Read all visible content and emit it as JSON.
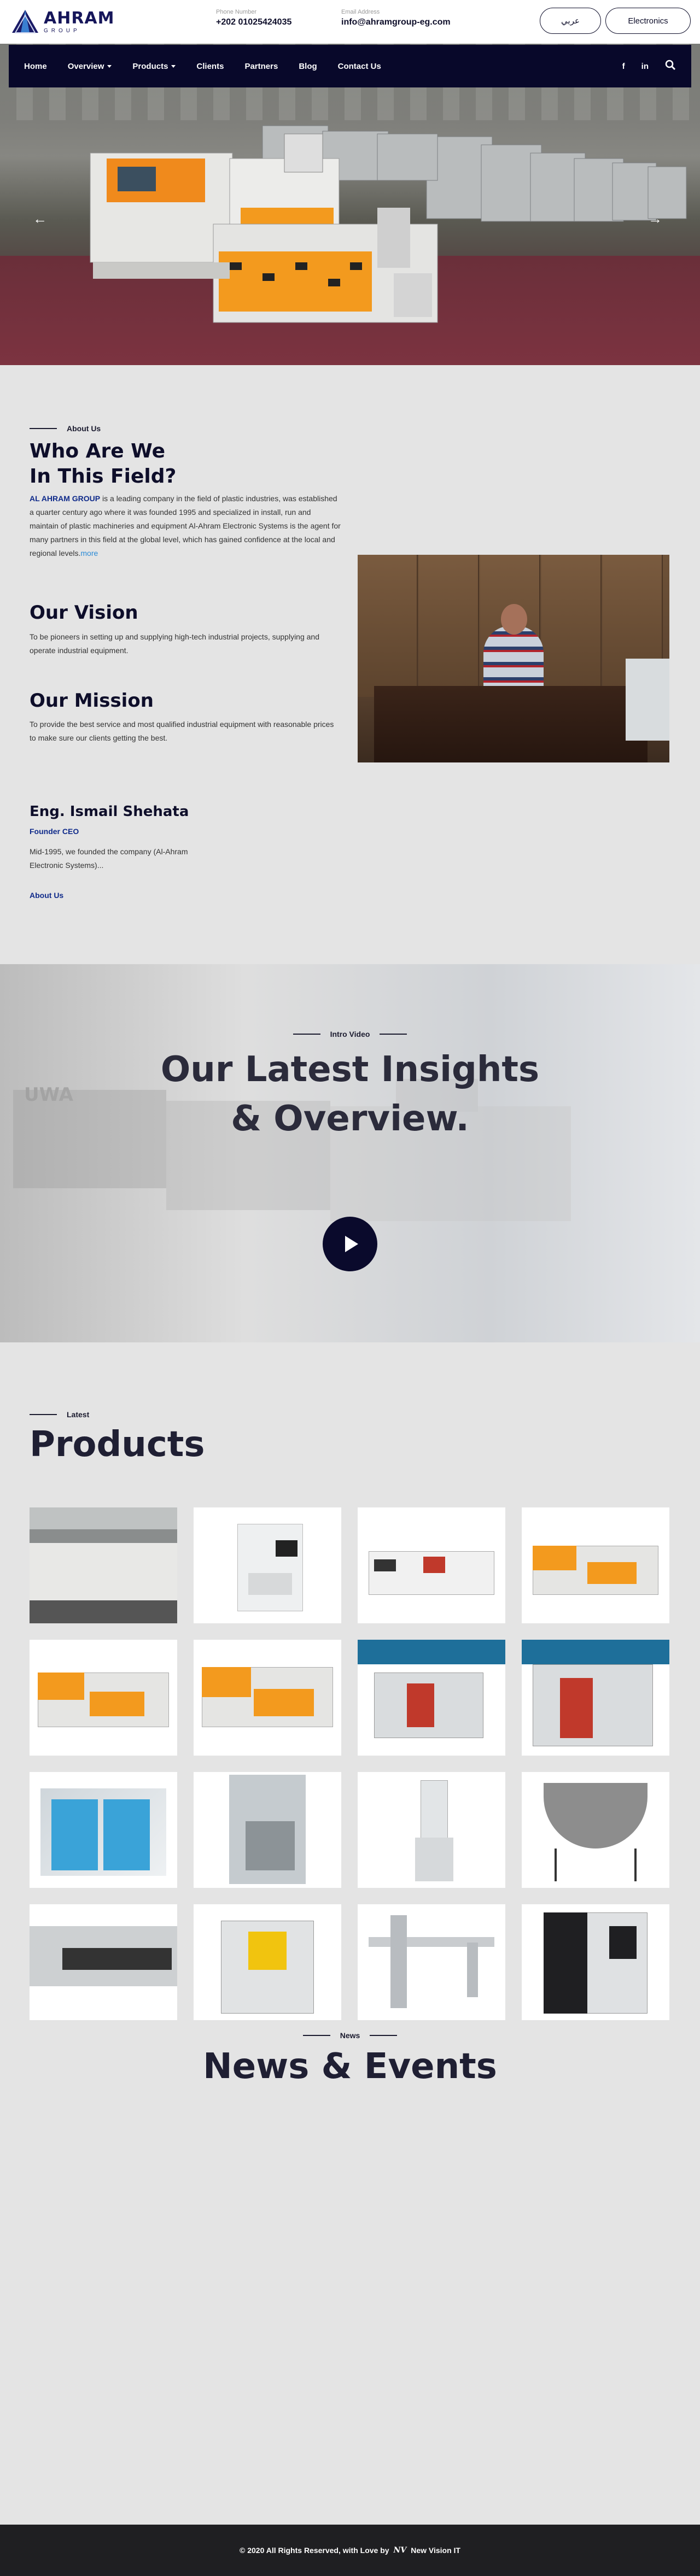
{
  "header": {
    "logo_name": "AHRAM",
    "logo_sub": "GROUP",
    "phone_label": "Phone Number",
    "phone_value": "+202 01025424035",
    "email_label": "Email Address",
    "email_value": "info@ahramgroup-eg.com",
    "lang_button": "عربي",
    "electronics_button": "Electronics"
  },
  "nav": {
    "items": [
      {
        "label": "Home"
      },
      {
        "label": "Overview"
      },
      {
        "label": "Products"
      },
      {
        "label": "Clients"
      },
      {
        "label": "Partners"
      },
      {
        "label": "Blog"
      },
      {
        "label": "Contact Us"
      }
    ],
    "social_facebook": "f",
    "social_linkedin": "in"
  },
  "hero": {
    "prev_arrow": "←",
    "next_arrow": "→"
  },
  "about": {
    "eyebrow": "About Us",
    "title_line1": "Who Are We",
    "title_line2": "In This Field?",
    "company_name": "AL AHRAM GROUP",
    "intro": " is a leading company in the field of plastic industries, was established a quarter century ago where it was founded 1995 and specialized in install, run and maintain of plastic machineries and equipment Al-Ahram Electronic Systems is the agent for many partners in this field at the global level, which has gained confidence at the local and regional levels.",
    "more": "more",
    "vision_title": "Our Vision",
    "vision_text": "To be pioneers in setting up and supplying high-tech industrial projects, supplying and operate industrial equipment.",
    "mission_title": "Our Mission",
    "mission_text": "To provide the best service and most qualified industrial equipment with reasonable prices to make sure our clients getting the best.",
    "founder_name": "Eng. Ismail Shehata",
    "founder_role": "Founder CEO",
    "founder_text": "Mid-1995, we founded the company (Al-Ahram Electronic Systems)...",
    "about_link": "About Us"
  },
  "video": {
    "eyebrow": "Intro Video",
    "title_line1": "Our Latest Insights",
    "title_line2": "& Overview."
  },
  "products": {
    "eyebrow": "Latest",
    "title": "Products",
    "items": [
      "line-machine",
      "inspection-machine",
      "injection-machine-white",
      "injection-machine-orange",
      "injection-machine-orange-2",
      "injection-machine-orange-3",
      "blow-molding-machine",
      "blow-molding-machine-2",
      "water-chiller",
      "granulator",
      "hopper-dryer",
      "mixing-bowl",
      "extruder",
      "film-machine",
      "robot-arm",
      "cnc-machine"
    ]
  },
  "news": {
    "eyebrow": "News",
    "title": "News & Events"
  },
  "footer": {
    "text": "© 2020 All Rights Reserved, with Love by",
    "brand_mark": "NV",
    "brand": "New Vision IT"
  },
  "colors": {
    "navy": "#08082a",
    "accent_orange": "#f39a1e",
    "link_blue": "#2a8ad6"
  }
}
